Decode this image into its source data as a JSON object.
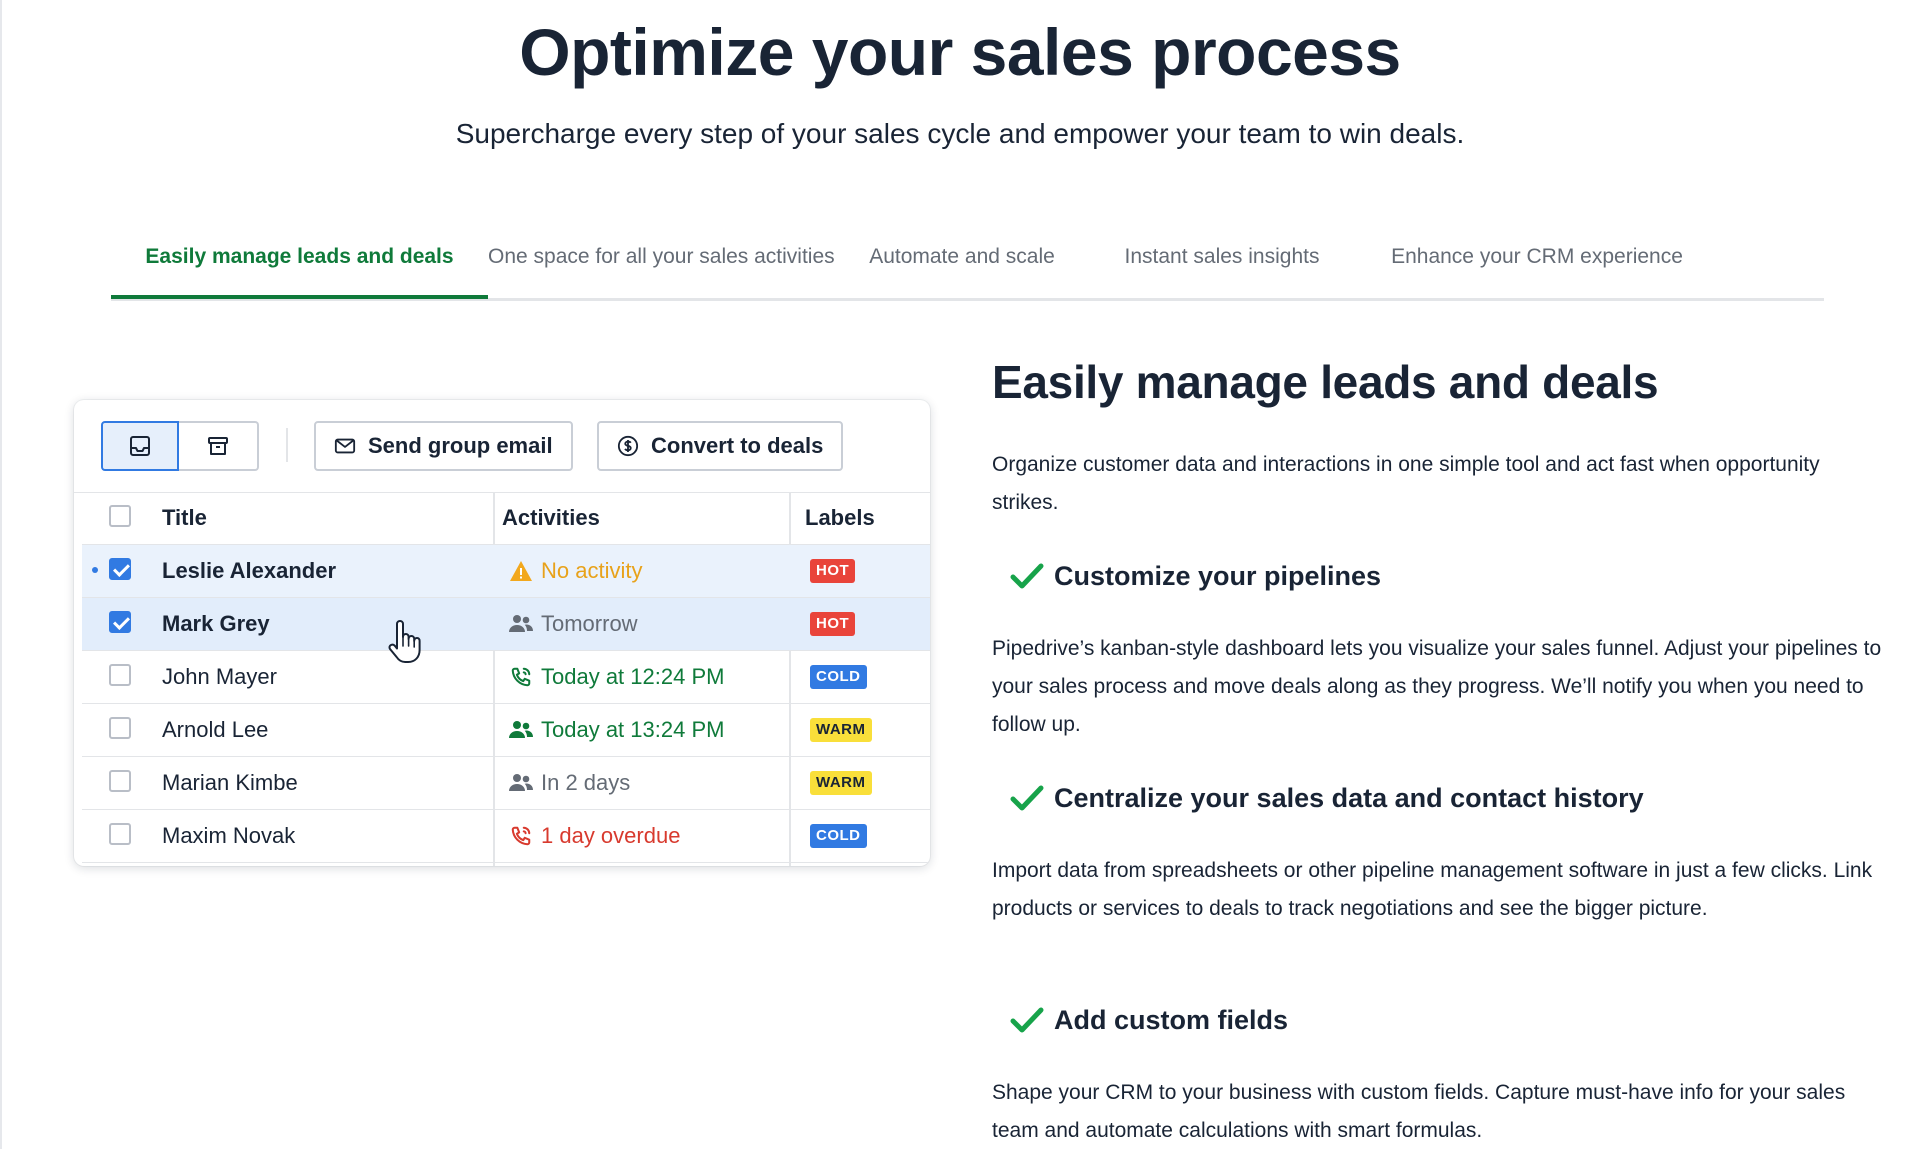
{
  "hero": {
    "title": "Optimize your sales process",
    "subtitle": "Supercharge every step of your sales cycle and empower your team to win deals."
  },
  "tabs": [
    {
      "label": "Easily manage leads and deals",
      "active": true
    },
    {
      "label": "One space for all your sales activities",
      "active": false
    },
    {
      "label": "Automate and scale",
      "active": false
    },
    {
      "label": "Instant sales insights",
      "active": false
    },
    {
      "label": "Enhance your CRM experience",
      "active": false
    }
  ],
  "demo": {
    "toolbar": {
      "inbox_icon": "inbox-icon",
      "archive_icon": "archive-icon",
      "send_email_label": "Send group email",
      "convert_label": "Convert to deals"
    },
    "columns": {
      "title": "Title",
      "activities": "Activities",
      "labels": "Labels"
    },
    "rows": [
      {
        "title": "Leslie Alexander",
        "checked": true,
        "activity": "No activity",
        "activity_icon": "warning-icon",
        "activity_color": "#e8a21a",
        "label": "HOT"
      },
      {
        "title": "Mark Grey",
        "checked": true,
        "activity": "Tomorrow",
        "activity_icon": "people-icon",
        "activity_color": "#646b75",
        "label": "HOT"
      },
      {
        "title": "John Mayer",
        "checked": false,
        "activity": "Today at 12:24 PM",
        "activity_icon": "phone-icon",
        "activity_color": "#0f7a3a",
        "label": "COLD"
      },
      {
        "title": "Arnold Lee",
        "checked": false,
        "activity": "Today at 13:24 PM",
        "activity_icon": "people-icon",
        "activity_color": "#0f7a3a",
        "label": "WARM"
      },
      {
        "title": "Marian Kimbe",
        "checked": false,
        "activity": "In 2 days",
        "activity_icon": "people-icon",
        "activity_color": "#646b75",
        "label": "WARM"
      },
      {
        "title": "Maxim Novak",
        "checked": false,
        "activity": "1 day overdue",
        "activity_icon": "phone-icon",
        "activity_color": "#d83a2e",
        "label": "COLD"
      }
    ]
  },
  "feature": {
    "title": "Easily manage leads and deals",
    "intro": "Organize customer data and interactions in one simple tool and act fast when opportunity strikes.",
    "bullets": [
      {
        "title": "Customize your pipelines",
        "text": "Pipedrive’s kanban-style dashboard lets you visualize your sales funnel. Adjust your pipelines to your sales process and move deals along as they progress. We’ll notify you when you need to follow up."
      },
      {
        "title": "Centralize your sales data and contact history",
        "text": "Import data from spreadsheets or other pipeline management software in just a few clicks. Link products or services to deals to track negotiations and see the bigger picture."
      },
      {
        "title": "Add custom fields",
        "text": "Shape your CRM to your business with custom fields. Capture must-have info for your sales team and automate calculations with smart formulas."
      }
    ]
  },
  "colors": {
    "accent_green": "#0f7a3a",
    "check_green": "#17a34a",
    "selection_blue": "#317ae2",
    "text_dark": "#192435"
  }
}
